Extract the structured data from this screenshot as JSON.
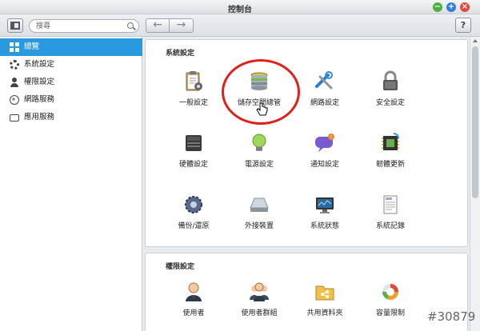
{
  "window": {
    "title": "控制台"
  },
  "toolbar": {
    "search_placeholder": "搜尋",
    "back_label": "←",
    "forward_label": "→",
    "help_label": "?"
  },
  "sidebar": {
    "items": [
      {
        "label": "總覽",
        "icon": "grid-icon",
        "active": true
      },
      {
        "label": "系統設定",
        "icon": "gear-icon",
        "active": false
      },
      {
        "label": "權限設定",
        "icon": "user-icon",
        "active": false
      },
      {
        "label": "網路服務",
        "icon": "globe-icon",
        "active": false
      },
      {
        "label": "應用服務",
        "icon": "drive-icon",
        "active": false
      }
    ]
  },
  "system_settings": {
    "title": "系統設定",
    "items": [
      {
        "label": "一般設定",
        "icon": "clipboard-settings-icon"
      },
      {
        "label": "儲存空間總管",
        "icon": "storage-disk-icon"
      },
      {
        "label": "網路設定",
        "icon": "network-tools-icon"
      },
      {
        "label": "安全設定",
        "icon": "padlock-icon"
      },
      {
        "label": "硬體設定",
        "icon": "hardware-icon"
      },
      {
        "label": "電源設定",
        "icon": "lightbulb-icon"
      },
      {
        "label": "通知設定",
        "icon": "notification-bubble-icon"
      },
      {
        "label": "韌體更新",
        "icon": "firmware-chip-icon"
      },
      {
        "label": "備份/還原",
        "icon": "backup-restore-gear-icon"
      },
      {
        "label": "外接裝置",
        "icon": "external-drive-icon"
      },
      {
        "label": "系統狀態",
        "icon": "monitor-icon"
      },
      {
        "label": "系統記錄",
        "icon": "log-document-icon"
      }
    ]
  },
  "privilege_settings": {
    "title": "權限設定",
    "items": [
      {
        "label": "使用者",
        "icon": "user-avatar-icon"
      },
      {
        "label": "使用者群組",
        "icon": "user-group-icon"
      },
      {
        "label": "共用資料夾",
        "icon": "shared-folder-icon"
      },
      {
        "label": "容量限制",
        "icon": "quota-chart-icon"
      }
    ]
  },
  "watermark": "#30879"
}
